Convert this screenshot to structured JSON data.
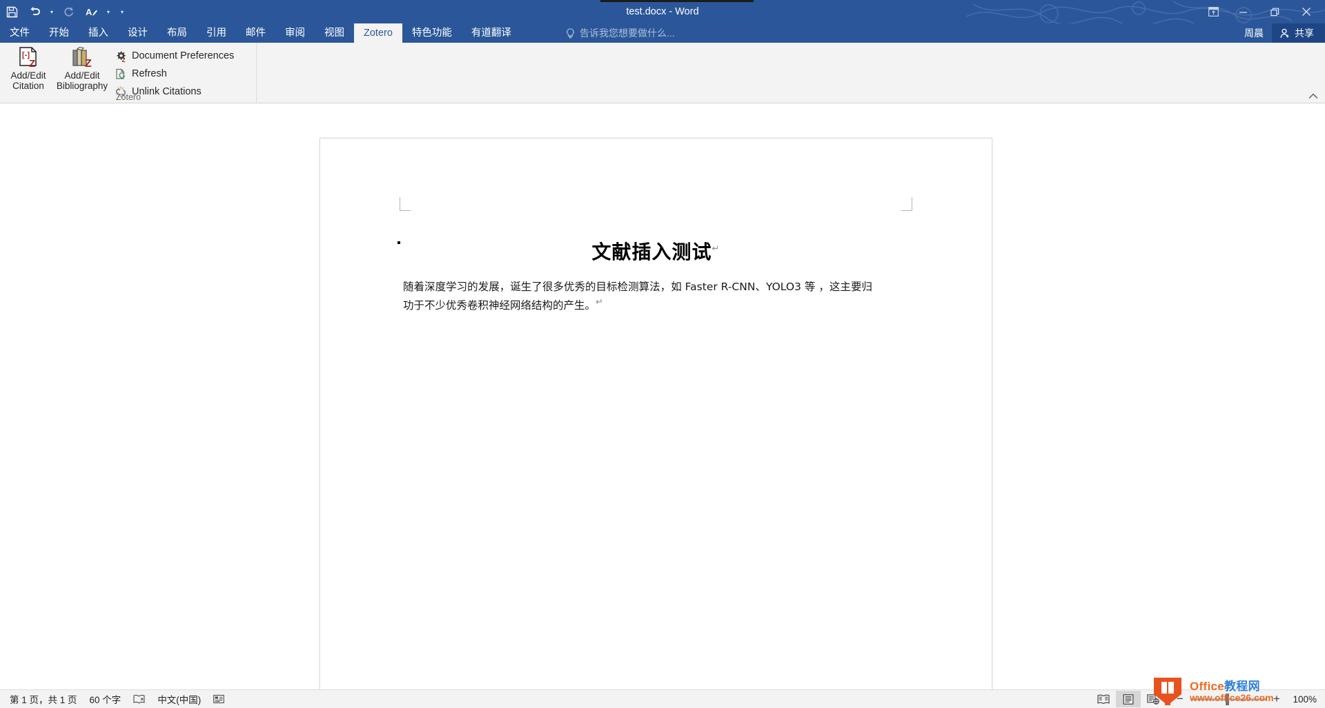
{
  "window": {
    "title": "test.docx - Word",
    "quick_access": [
      {
        "name": "save-icon",
        "label": "保存"
      },
      {
        "name": "undo-icon",
        "label": "撤消"
      },
      {
        "name": "redo-icon",
        "label": "恢复"
      },
      {
        "name": "repeat-format-icon",
        "label": "重复格式"
      },
      {
        "name": "customize-qat-icon",
        "label": "自定义快速访问工具栏"
      }
    ],
    "controls": {
      "ribbon_display": "功能区显示选项",
      "minimize": "最小化",
      "restore": "向下还原",
      "close": "关闭"
    }
  },
  "tabs": [
    {
      "label": "文件",
      "active": false
    },
    {
      "label": "开始",
      "active": false
    },
    {
      "label": "插入",
      "active": false
    },
    {
      "label": "设计",
      "active": false
    },
    {
      "label": "布局",
      "active": false
    },
    {
      "label": "引用",
      "active": false
    },
    {
      "label": "邮件",
      "active": false
    },
    {
      "label": "审阅",
      "active": false
    },
    {
      "label": "视图",
      "active": false
    },
    {
      "label": "Zotero",
      "active": true
    },
    {
      "label": "特色功能",
      "active": false
    },
    {
      "label": "有道翻译",
      "active": false
    }
  ],
  "tell_me": {
    "placeholder": "告诉我您想要做什么..."
  },
  "account": {
    "name": "周晨",
    "share_label": "共享"
  },
  "ribbon": {
    "group_label": "Zotero",
    "big_buttons": [
      {
        "name": "add-edit-citation-button",
        "line1": "Add/Edit",
        "line2": "Citation",
        "icon": "citation-document-icon"
      },
      {
        "name": "add-edit-bibliography-button",
        "line1": "Add/Edit",
        "line2": "Bibliography",
        "icon": "bibliography-books-icon"
      }
    ],
    "small_buttons": [
      {
        "name": "document-preferences-button",
        "label": "Document Preferences",
        "icon": "gear-z-icon"
      },
      {
        "name": "refresh-button",
        "label": "Refresh",
        "icon": "refresh-icon"
      },
      {
        "name": "unlink-citations-button",
        "label": "Unlink Citations",
        "icon": "unlink-icon"
      }
    ],
    "collapse_label": "折叠功能区"
  },
  "document": {
    "title": "文献插入测试",
    "pilcrow": "↵",
    "body_paragraph": "随着深度学习的发展，诞生了很多优秀的目标检测算法，如 Faster R-CNN、YOLO3 等 ，这主要归功于不少优秀卷积神经网络结构的产生。",
    "body_pilcrow": "↵"
  },
  "status_bar": {
    "page_info": "第 1 页，共 1 页",
    "word_count": "60 个字",
    "proofing_icon": "proofing-errors-icon",
    "language": "中文(中国)",
    "macro_icon": "record-macro-icon",
    "views": [
      {
        "name": "read-mode-button",
        "label": "阅读视图",
        "active": false
      },
      {
        "name": "print-layout-button",
        "label": "页面视图",
        "active": true
      },
      {
        "name": "web-layout-button",
        "label": "Web 版式视图",
        "active": false
      }
    ],
    "zoom": {
      "minus": "−",
      "plus": "+",
      "percent": "100%",
      "value": 100
    }
  },
  "watermark": {
    "brand_en": "Office",
    "brand_cn": "教程网",
    "url": "www.office26.com"
  },
  "colors": {
    "word_blue": "#2b579a",
    "ribbon_bg": "#f3f3f3",
    "accent_orange": "#f06a1e",
    "zotero_red": "#a62a21"
  }
}
